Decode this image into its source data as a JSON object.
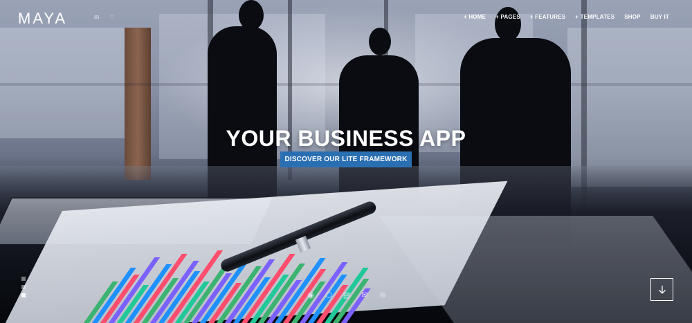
{
  "brand": {
    "logo": "MAYA"
  },
  "top_icons": [
    {
      "name": "mail-icon",
      "glyph": "✉"
    },
    {
      "name": "heart-icon",
      "glyph": "♡"
    }
  ],
  "nav": {
    "items": [
      {
        "label": "+ HOME"
      },
      {
        "label": "+ PAGES"
      },
      {
        "label": "+ FEATURES"
      },
      {
        "label": "+ TEMPLATES"
      },
      {
        "label": "SHOP"
      },
      {
        "label": "BUY IT"
      }
    ]
  },
  "hero": {
    "headline": "YOUR BUSINESS APP",
    "cta_label": "DISCOVER OUR LITE FRAMEWORK",
    "accent_color": "#2b6fb3"
  },
  "slider": {
    "slides": 3,
    "active_index": 2
  },
  "bottom_icons": [
    {
      "name": "eye-icon",
      "glyph": "◉"
    },
    {
      "name": "cube-icon",
      "glyph": "⬡"
    },
    {
      "name": "document-icon",
      "glyph": "▤"
    },
    {
      "name": "envelope-icon",
      "glyph": "✉"
    },
    {
      "name": "globe-icon",
      "glyph": "⊕"
    }
  ],
  "scroll": {
    "icon": "arrow-down-icon",
    "glyph": "↓"
  }
}
